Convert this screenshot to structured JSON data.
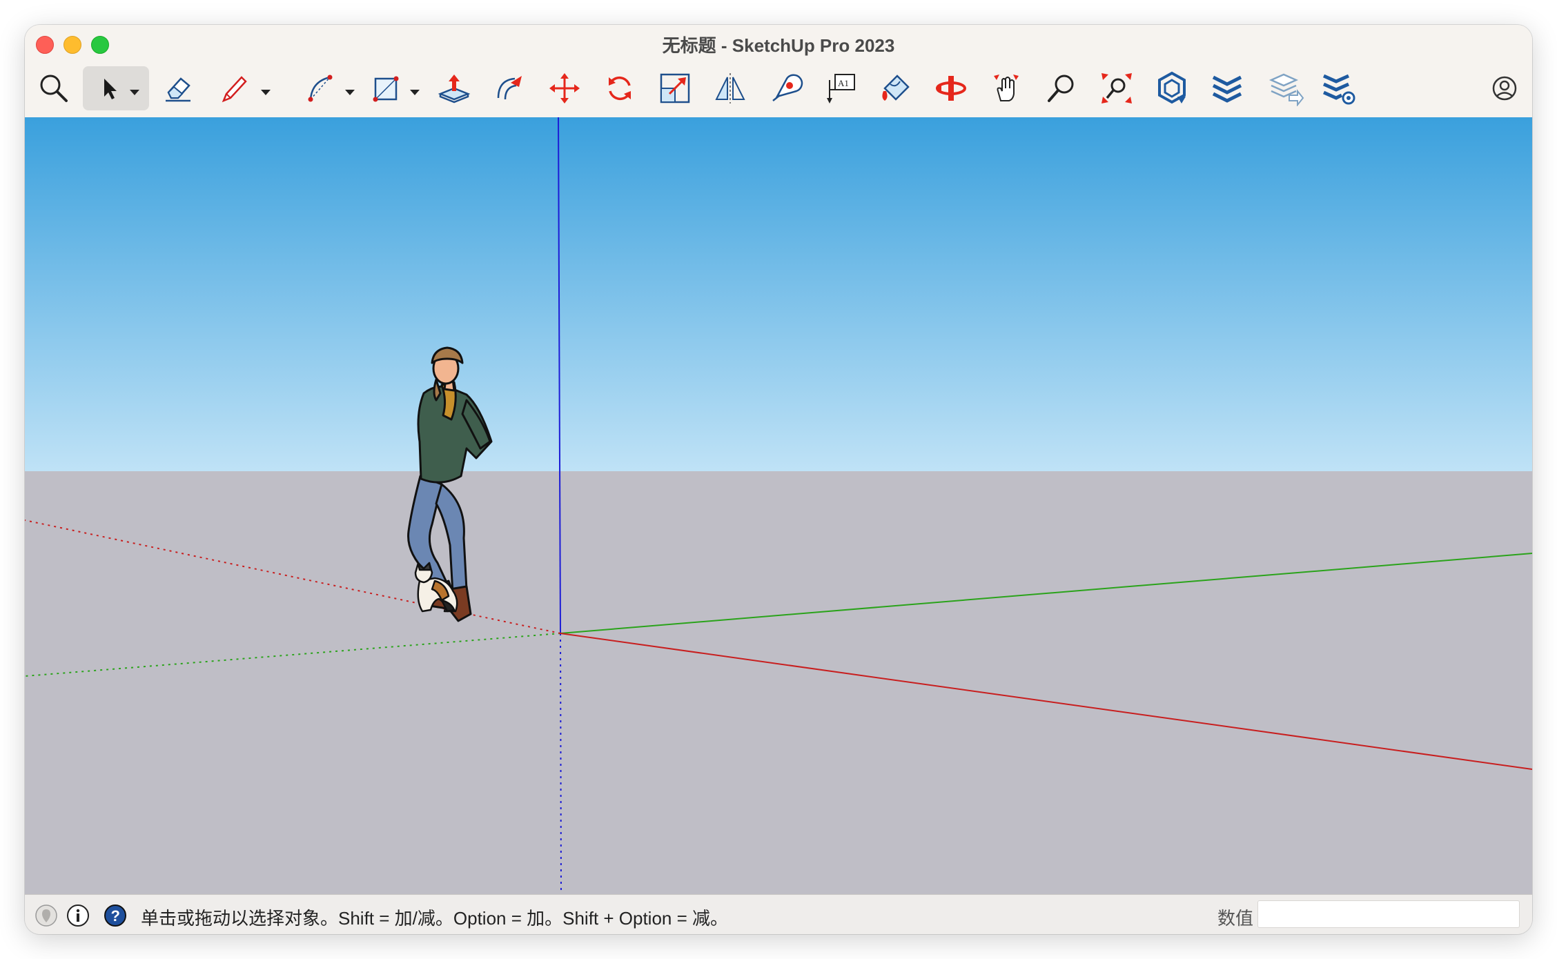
{
  "window": {
    "title": "无标题 - SketchUp Pro 2023"
  },
  "toolbar": {
    "tools": [
      {
        "name": "search-icon"
      },
      {
        "name": "select-arrow-icon",
        "active": true
      },
      {
        "name": "eraser-icon"
      },
      {
        "name": "pencil-line-icon"
      },
      {
        "name": "arc-icon"
      },
      {
        "name": "rectangle-icon"
      },
      {
        "name": "push-pull-icon"
      },
      {
        "name": "offset-icon"
      },
      {
        "name": "move-icon"
      },
      {
        "name": "rotate-icon"
      },
      {
        "name": "scale-icon"
      },
      {
        "name": "flip-icon"
      },
      {
        "name": "tape-measure-icon"
      },
      {
        "name": "text-label-icon"
      },
      {
        "name": "paint-bucket-icon"
      },
      {
        "name": "orbit-icon"
      },
      {
        "name": "pan-icon"
      },
      {
        "name": "zoom-icon"
      },
      {
        "name": "zoom-extents-icon"
      },
      {
        "name": "warehouse-icon"
      },
      {
        "name": "extension-warehouse-icon"
      },
      {
        "name": "send-to-layout-icon"
      },
      {
        "name": "extension-manager-icon"
      },
      {
        "name": "account-icon"
      }
    ]
  },
  "statusbar": {
    "message": "单击或拖动以选择对象。Shift = 加/减。Option = 加。Shift + Option = 减。",
    "measurements_label": "数值",
    "measurements_value": ""
  },
  "colors": {
    "sky_top": "#3aa0dd",
    "sky_bottom": "#bfe2f6",
    "ground": "#bfbec6",
    "axis_red": "#c81e1e",
    "axis_green": "#2aa31a",
    "axis_blue": "#1c1cd6"
  }
}
